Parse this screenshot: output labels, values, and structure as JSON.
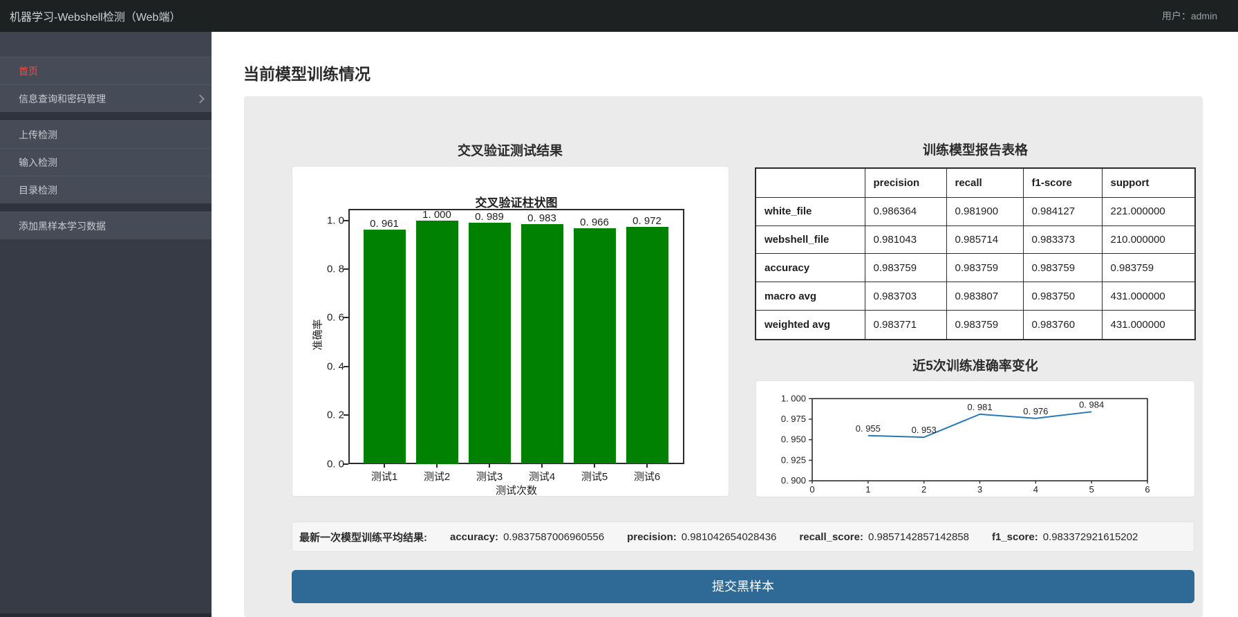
{
  "navbar": {
    "title": "机器学习-Webshell检测（Web端）",
    "user_label": "用户：admin"
  },
  "sidebar": {
    "items": [
      {
        "key": "home",
        "label": "首页",
        "active": true
      },
      {
        "key": "info-query-password",
        "label": "信息查询和密码管理",
        "chevron": true
      },
      {
        "gap": true
      },
      {
        "key": "upload-detect",
        "label": "上传检测"
      },
      {
        "key": "input-detect",
        "label": "输入检测"
      },
      {
        "key": "dir-detect",
        "label": "目录检测"
      },
      {
        "gap": true
      },
      {
        "key": "add-black-sample",
        "label": "添加黑样本学习数据"
      }
    ]
  },
  "main": {
    "page_title": "当前模型训练情况",
    "submit_button": "提交黑样本",
    "summary": {
      "prefix": "最新一次模型训练平均结果:",
      "metrics": [
        {
          "label": "accuracy:",
          "value": "0.9837587006960556"
        },
        {
          "label": "precision:",
          "value": "0.981042654028436"
        },
        {
          "label": "recall_score:",
          "value": "0.9857142857142858"
        },
        {
          "label": "f1_score:",
          "value": "0.983372921615202"
        }
      ]
    }
  },
  "chart_data": [
    {
      "type": "bar",
      "section_title": "交叉验证测试结果",
      "title": "交叉验证柱状图",
      "categories": [
        "测试1",
        "测试2",
        "测试3",
        "测试4",
        "测试5",
        "测试6"
      ],
      "values": [
        0.961,
        1.0,
        0.989,
        0.983,
        0.966,
        0.972
      ],
      "value_labels": [
        "0. 961",
        "1. 000",
        "0. 989",
        "0. 983",
        "0. 966",
        "0. 972"
      ],
      "xlabel": "测试次数",
      "ylabel": "准确率",
      "ytick_values": [
        0,
        0.2,
        0.4,
        0.6,
        0.8,
        1.0
      ],
      "ytick_labels": [
        "0. 0",
        "0. 2",
        "0. 4",
        "0. 6",
        "0. 8",
        "1. 0"
      ],
      "ylim": [
        0,
        1.047
      ],
      "bar_color": "#018101",
      "grid": false
    },
    {
      "type": "line",
      "section_title": "近5次训练准确率变化",
      "x": [
        1,
        2,
        3,
        4,
        5
      ],
      "values": [
        0.955,
        0.953,
        0.981,
        0.976,
        0.984
      ],
      "point_labels": [
        "0. 955",
        "0. 953",
        "0. 981",
        "0. 976",
        "0. 984"
      ],
      "ytick_values": [
        1.0,
        0.975,
        0.95,
        0.925,
        0.9
      ],
      "ytick_labels": [
        "1. 000",
        "0. 975",
        "0. 950",
        "0. 925",
        "0. 900"
      ],
      "xtick_labels": [
        "0",
        "1",
        "2",
        "3",
        "4",
        "5",
        "6"
      ],
      "xlim": [
        0,
        6
      ],
      "ylim": [
        0.9,
        1.0
      ],
      "line_color": "#2878b5",
      "grid": false
    }
  ],
  "table": {
    "section_title": "训练模型报告表格",
    "headers": [
      "",
      "precision",
      "recall",
      "f1-score",
      "support"
    ],
    "rows": [
      [
        "white_file",
        "0.986364",
        "0.981900",
        "0.984127",
        "221.000000"
      ],
      [
        "webshell_file",
        "0.981043",
        "0.985714",
        "0.983373",
        "210.000000"
      ],
      [
        "accuracy",
        "0.983759",
        "0.983759",
        "0.983759",
        "0.983759"
      ],
      [
        "macro avg",
        "0.983703",
        "0.983807",
        "0.983750",
        "431.000000"
      ],
      [
        "weighted avg",
        "0.983771",
        "0.983759",
        "0.983760",
        "431.000000"
      ]
    ]
  }
}
